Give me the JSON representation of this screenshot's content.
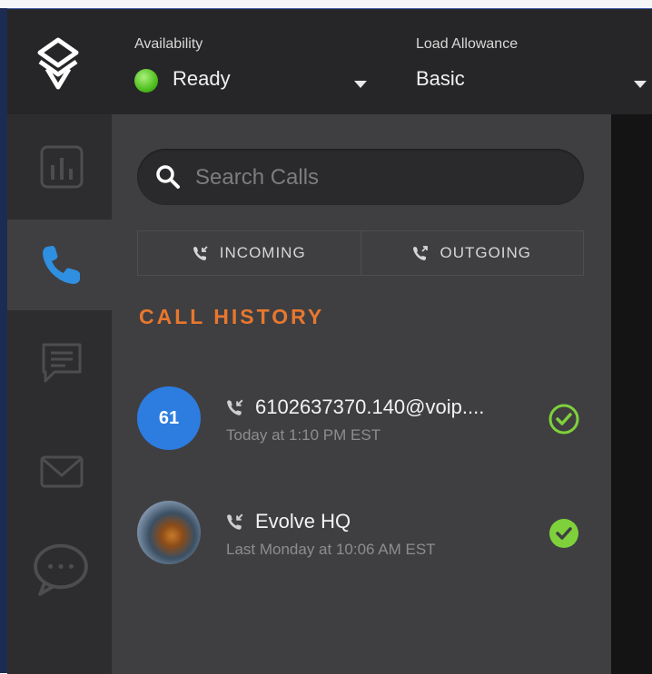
{
  "header": {
    "availability_label": "Availability",
    "availability_value": "Ready",
    "load_label": "Load Allowance",
    "load_value": "Basic"
  },
  "rail": {
    "icons": [
      "analytics-icon",
      "phone-icon",
      "chat-transcript-icon",
      "mail-icon",
      "chat-bubble-icon"
    ],
    "active": "phone-icon"
  },
  "search": {
    "placeholder": "Search Calls"
  },
  "tabs": {
    "incoming": "INCOMING",
    "outgoing": "OUTGOING"
  },
  "call_history": {
    "title": "CALL HISTORY",
    "items": [
      {
        "avatar_text": "61",
        "name": "6102637370.140@voip....",
        "time": "Today at 1:10 PM EST",
        "status_icon": "check-outline-icon"
      },
      {
        "avatar_text": "",
        "name": "Evolve HQ",
        "time": "Last Monday at 10:06 AM EST",
        "status_icon": "check-filled-icon"
      }
    ]
  },
  "colors": {
    "accent_orange": "#e8772e",
    "phone_blue": "#2f8fe0",
    "ready_green": "#4fbf1f",
    "check_green": "#7fd13b"
  }
}
